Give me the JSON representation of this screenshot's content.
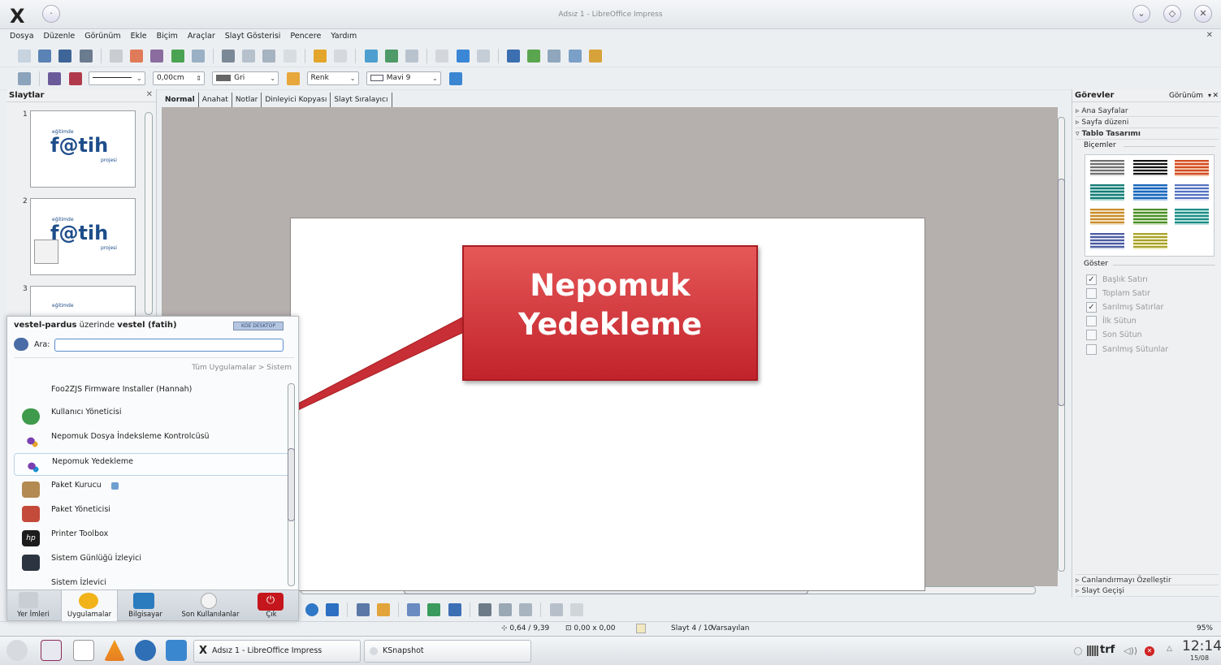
{
  "window": {
    "title": "Adsız 1 - LibreOffice Impress",
    "logo": "X"
  },
  "menu": [
    "Dosya",
    "Düzenle",
    "Görünüm",
    "Ekle",
    "Biçim",
    "Araçlar",
    "Slayt Gösterisi",
    "Pencere",
    "Yardım"
  ],
  "format_bar": {
    "line_width": "0,00cm",
    "fill_color": "Gri",
    "fill_type": "Renk",
    "fill_value": "Mavi 9"
  },
  "slides_panel": {
    "title": "Slaytlar",
    "slide_numbers": [
      "1",
      "2",
      "3"
    ],
    "thumb_caption_small": "eğitimde",
    "thumb_caption_large": "f@tih",
    "thumb_subtitle": "projesi"
  },
  "view_tabs": [
    "Normal",
    "Anahat",
    "Notlar",
    "Dinleyici Kopyası",
    "Slayt Sıralayıcı"
  ],
  "callout": {
    "line1": "Nepomuk",
    "line2": "Yedekleme",
    "fill": "#d63a40"
  },
  "tasks_panel": {
    "title": "Görevler",
    "view_menu": "Görünüm",
    "sections": [
      "Ana Sayfalar",
      "Sayfa düzeni",
      "Tablo Tasarımı"
    ],
    "styles_label": "Biçemler",
    "show_label": "Göster",
    "options": [
      {
        "label": "Başlık Satırı",
        "checked": true
      },
      {
        "label": "Toplam Satır",
        "checked": false
      },
      {
        "label": "Sarılmış Satırlar",
        "checked": true
      },
      {
        "label": "İlk Sütun",
        "checked": false
      },
      {
        "label": "Son Sütun",
        "checked": false
      },
      {
        "label": "Sarılmış Sütunlar",
        "checked": false
      }
    ],
    "bottom_sections": [
      "Canlandırmayı Özelleştir",
      "Slayt Geçişi"
    ]
  },
  "launcher": {
    "host_prefix": "vestel-pardus",
    "host_mid": " üzerinde ",
    "user": "vestel (fatih)",
    "badge": "KDE DESKTOP",
    "search_label": "Ara:",
    "breadcrumb": "Tüm Uygulamalar >  Sistem",
    "apps": [
      "Foo2ZJS Firmware Installer (Hannah)",
      "Kullanıcı Yöneticisi",
      "Nepomuk Dosya İndeksleme Kontrolcüsü",
      "Nepomuk Yedekleme",
      "Paket Kurucu",
      "Paket Yöneticisi",
      "Printer Toolbox",
      "Sistem Günlüğü İzleyici",
      "Sistem İzlevici"
    ],
    "tabs": [
      "Yer İmleri",
      "Uygulamalar",
      "Bilgisayar",
      "Son Kullanılanlar",
      "Çık"
    ]
  },
  "status": {
    "position": "0,64 / 9,39",
    "size": "0,00 x 0,00",
    "slide": "Slayt 4 / 10",
    "layout": "Varsayılan",
    "zoom": "95%"
  },
  "taskbar": {
    "tasks": [
      "Adsız 1 - LibreOffice Impress",
      "KSnapshot"
    ],
    "keyboard": "trf",
    "time": "12:14",
    "date": "15/08"
  }
}
